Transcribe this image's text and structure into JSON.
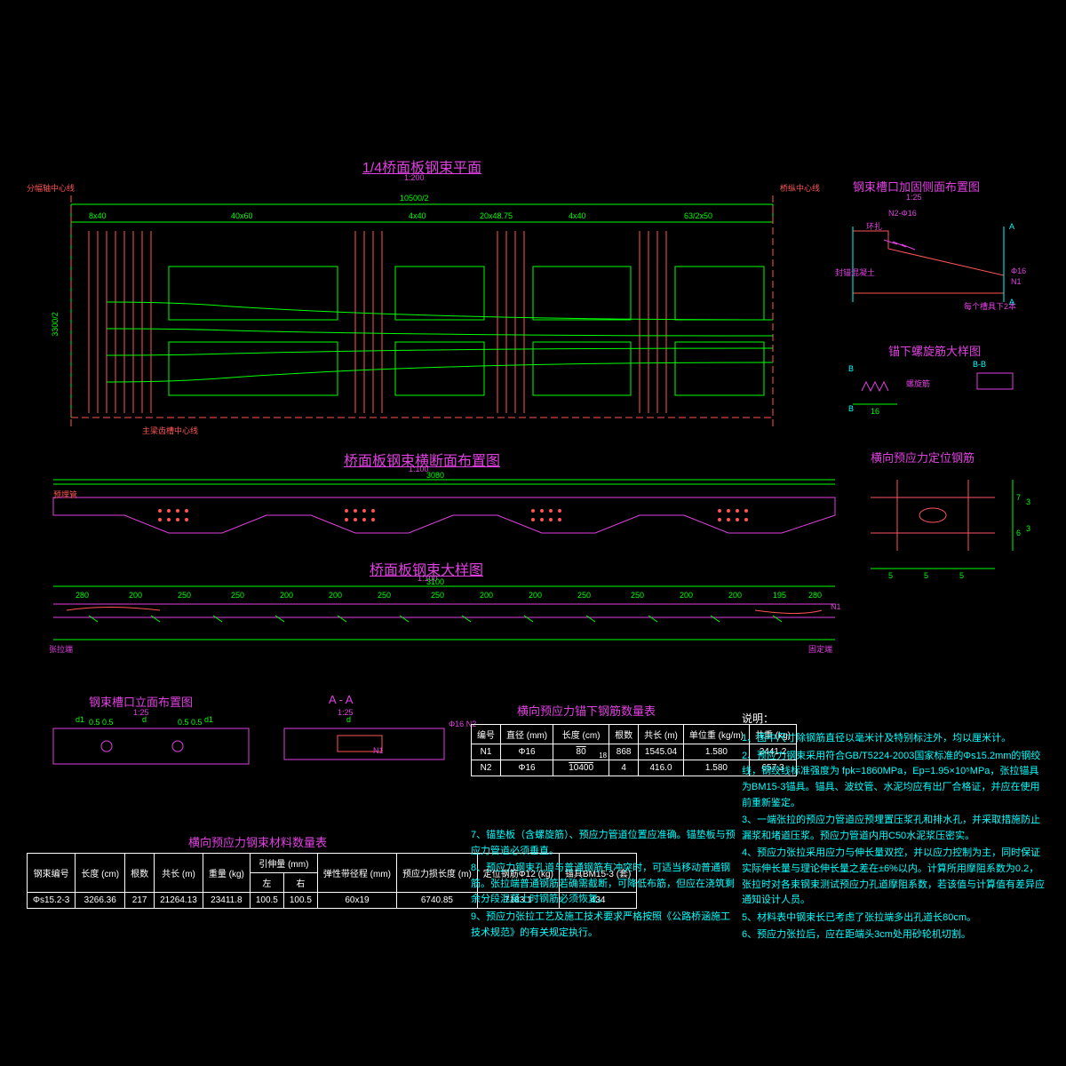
{
  "titles": {
    "plan": "1/4桥面板钢束平面",
    "plan_scale": "1:200",
    "section": "桥面板钢束横断面布置图",
    "section_scale": "1:100",
    "detail": "桥面板钢束大样图",
    "detail_scale": "1:100",
    "notch_elev": "钢束槽口立面布置图",
    "notch_elev_scale": "1:25",
    "aa": "A - A",
    "aa_scale": "1:25",
    "notch_sec": "钢束槽口加固侧面布置图",
    "notch_sec_scale": "1:25",
    "spiral": "锚下螺旋筋大样图",
    "locate": "横向预应力定位钢筋",
    "tbl1": "横向预应力钢束材料数量表",
    "tbl2": "横向预应力锚下钢筋数量表"
  },
  "dims": {
    "top_total": "10500/2",
    "top_segs": [
      "8x40",
      "40x60",
      "4x40",
      "20x48.75",
      "4x40",
      "63/2x50"
    ],
    "left_h": "3300/2",
    "sec_w": "3080",
    "det_w": "3100",
    "det_segs": [
      "280",
      "200",
      "250",
      "250",
      "200",
      "200",
      "250",
      "250",
      "200",
      "200",
      "250",
      "250",
      "200",
      "200",
      "195",
      "280"
    ],
    "plan_axis_left": "分幅轴中心线",
    "plan_axis_right": "桥纵中心线",
    "girder_axis": "主梁齿槽中心线",
    "anchor_left": "张拉端",
    "anchor_right": "固定端",
    "n1": "N1",
    "n2": "N2",
    "phi16": "Φ16",
    "spiral_label": "螺旋筋",
    "every_notch": "每个槽具下2本",
    "bb": "B-B",
    "d": "d",
    "d1": "d1",
    "hoop": "环扎",
    "seal": "封锚混凝土",
    "pipe": "预埋管"
  },
  "table1": {
    "headers": [
      "钢束编号",
      "长度\n(cm)",
      "根数",
      "共长\n(m)",
      "重量\n(kg)",
      "引伸量 (mm)",
      "弹性带径程\n(mm)",
      "预应力损长度\n(m)",
      "定位钢筋Φ12\n(kg)",
      "锚具BM15-3\n(套)"
    ],
    "subheaders": [
      "左",
      "右"
    ],
    "row": [
      "Φs15.2-3",
      "3266.36",
      "217",
      "21264.13",
      "23411.8",
      "100.5",
      "100.5",
      "60x19",
      "6740.85",
      "7183.1",
      "434"
    ]
  },
  "table2": {
    "headers": [
      "编号",
      "直径\n(mm)",
      "长度\n(cm)",
      "根数",
      "共长\n(m)",
      "单位重\n(kg/m)",
      "共重\n(kg)"
    ],
    "rows": [
      [
        "N1",
        "Φ16",
        "80",
        "868",
        "1545.04",
        "1.580",
        "2441.2"
      ],
      [
        "N2",
        "Φ16",
        "10400",
        "4",
        "416.0",
        "1.580",
        "657.3"
      ]
    ],
    "len_top": "80",
    "len_gap": "18"
  },
  "notes": {
    "header": "说明：",
    "items": [
      "1、图中尺寸除钢筋直径以毫米计及特别标注外，均以厘米计。",
      "2、预应力钢束采用符合GB/T5224-2003国家标准的Φs15.2mm的钢绞线，钢绞线标准强度为 fpk=1860MPa，Ep=1.95×10⁵MPa，张拉锚具为BM15-3锚具。锚具、波纹管、水泥均应有出厂合格证，并应在使用前重新鉴定。",
      "3、一端张拉的预应力管道应预埋置压浆孔和排水孔，并采取措施防止漏浆和堵道压浆。预应力管道内用C50水泥浆压密实。",
      "4、预应力张拉采用应力与伸长量双控，并以应力控制为主，同时保证实际伸长量与理论伸长量之差在±6%以内。计算所用摩阻系数为0.2，张拉时对各束钢束测试预应力孔道摩阻系数，若该值与计算值有差异应通知设计人员。",
      "5、材料表中钢束长已考虑了张拉端多出孔道长80cm。",
      "6、预应力张拉后，应在距端头3cm处用砂轮机切割。",
      "7、锚垫板（含螺旋筋）、预应力管道位置应准确。锚垫板与预应力管道必须垂直。",
      "8、预应力钢束孔道与普通钢筋有冲突时，可适当移动普通钢筋。张拉端普通钢筋若确需截断，可降低布筋，但应在浇筑剩余分段混凝土时钢筋必须恢复。",
      "9、预应力张拉工艺及施工技术要求严格按照《公路桥涵施工技术规范》的有关规定执行。"
    ]
  }
}
